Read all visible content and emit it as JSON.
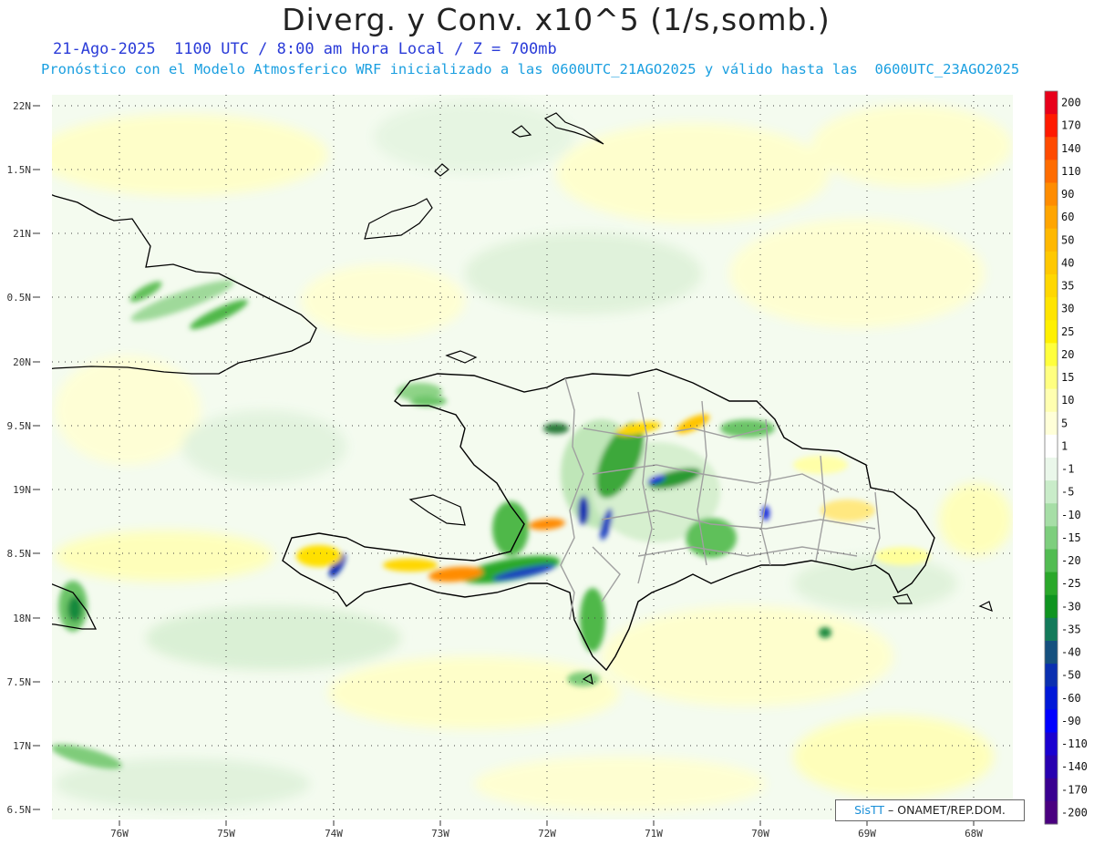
{
  "header": {
    "title": "Diverg. y Conv. x10^5 (1/s,somb.)",
    "subtitle_date": "21-Ago-2025  1100 UTC / 8:00 am Hora Local / Z = 700mb",
    "subtitle_model": "Pronóstico con el Modelo Atmosferico WRF inicializado a las 0600UTC_21AGO2025 y válido hasta las  0600UTC_23AGO2025"
  },
  "map": {
    "lat_labels": [
      "22N",
      "1.5N",
      "21N",
      "0.5N",
      "20N",
      "9.5N",
      "19N",
      "8.5N",
      "18N",
      "7.5N",
      "17N",
      "6.5N"
    ],
    "lon_labels": [
      "76W",
      "75W",
      "74W",
      "73W",
      "72W",
      "71W",
      "70W",
      "69W",
      "68W"
    ]
  },
  "colorbar": {
    "levels": [
      {
        "label": "200",
        "color": "#e8001a"
      },
      {
        "label": "170",
        "color": "#ff1a00"
      },
      {
        "label": "140",
        "color": "#ff4a00"
      },
      {
        "label": "110",
        "color": "#ff6c00"
      },
      {
        "label": "90",
        "color": "#ff8c00"
      },
      {
        "label": "60",
        "color": "#ffa500"
      },
      {
        "label": "50",
        "color": "#ffb800"
      },
      {
        "label": "40",
        "color": "#ffc800"
      },
      {
        "label": "35",
        "color": "#ffd700"
      },
      {
        "label": "30",
        "color": "#ffe400"
      },
      {
        "label": "25",
        "color": "#fff000"
      },
      {
        "label": "20",
        "color": "#ffff3c"
      },
      {
        "label": "15",
        "color": "#ffff80"
      },
      {
        "label": "10",
        "color": "#ffffb0"
      },
      {
        "label": "5",
        "color": "#ffffd8"
      },
      {
        "label": "1",
        "color": "#ffffff"
      },
      {
        "label": "-1",
        "color": "#eaf7ea"
      },
      {
        "label": "-5",
        "color": "#c9ecc9"
      },
      {
        "label": "-10",
        "color": "#a6dea6"
      },
      {
        "label": "-15",
        "color": "#7dce7d"
      },
      {
        "label": "-20",
        "color": "#52bc52"
      },
      {
        "label": "-25",
        "color": "#2aa82a"
      },
      {
        "label": "-30",
        "color": "#0f9420"
      },
      {
        "label": "-35",
        "color": "#137a5a"
      },
      {
        "label": "-40",
        "color": "#15507e"
      },
      {
        "label": "-50",
        "color": "#0a2fb0"
      },
      {
        "label": "-60",
        "color": "#0018d8"
      },
      {
        "label": "-90",
        "color": "#0000ff"
      },
      {
        "label": "-110",
        "color": "#1a00d0"
      },
      {
        "label": "-140",
        "color": "#2800b0"
      },
      {
        "label": "-170",
        "color": "#3a0090"
      },
      {
        "label": "-200",
        "color": "#4a0080"
      }
    ]
  },
  "credit": {
    "brand": "SisTT",
    "text": "– ONAMET/REP.DOM."
  },
  "colors": {
    "coast": "#000000",
    "province_border": "#a0a0a0",
    "grid": "#444444"
  }
}
